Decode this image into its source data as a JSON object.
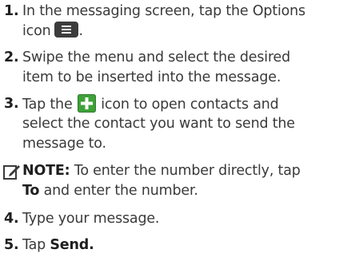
{
  "steps": [
    {
      "number": "1.",
      "lines": [
        "In the messaging screen, tap the Options",
        "icon",
        "."
      ]
    },
    {
      "number": "2.",
      "lines": [
        "Swipe the menu and select the desired",
        "item to be inserted into the message."
      ]
    },
    {
      "number": "3.",
      "lines": [
        "Tap the",
        "icon to open contacts and",
        "select the contact you want to send the",
        "message to."
      ]
    },
    {
      "note_label": "NOTE:",
      "lines": [
        "To enter the number directly, tap",
        "To",
        "and enter the number."
      ]
    },
    {
      "number": "4.",
      "lines": [
        "Type your message."
      ]
    },
    {
      "number": "5.",
      "lines": [
        "Tap",
        "Send."
      ]
    }
  ],
  "icons": {
    "options": "options-menu-icon",
    "add_contact": "add-contact-plus-icon",
    "note": "note-pencil-icon"
  },
  "colors": {
    "text": "#3a3a3a",
    "bold_text": "#1f1f1f",
    "plus_icon": "#3fa13a",
    "options_icon": "#3c3c3c"
  }
}
